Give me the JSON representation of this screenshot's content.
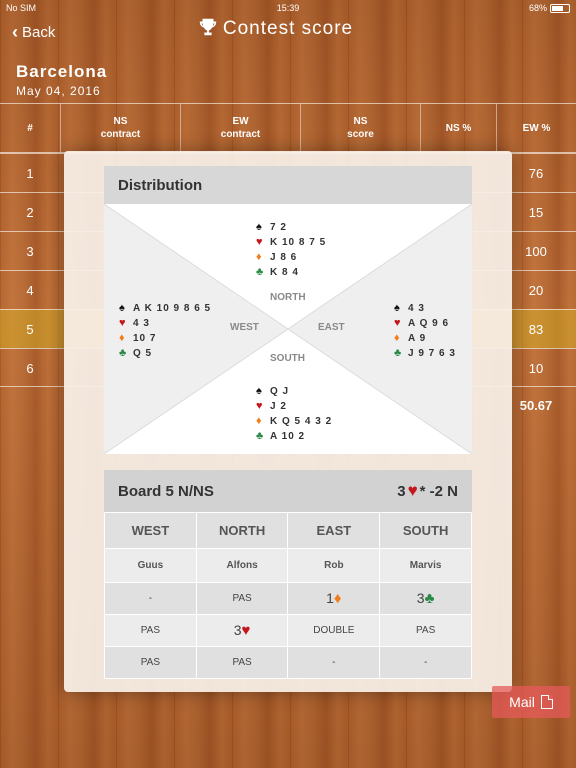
{
  "status": {
    "carrier": "No SIM",
    "time": "15:39",
    "battery": "68%"
  },
  "nav": {
    "back_label": "Back",
    "title": "Contest score"
  },
  "venue": {
    "name": "Barcelona",
    "date": "May 04, 2016"
  },
  "table": {
    "headers": {
      "num": "#",
      "ns_contract": "NS\ncontract",
      "ew_contract": "EW\ncontract",
      "ns_score": "NS\nscore",
      "ns_pct": "NS %",
      "ew_pct": "EW %"
    },
    "rows": [
      {
        "num": "1",
        "ew_pct": "76"
      },
      {
        "num": "2",
        "ew_pct": "15"
      },
      {
        "num": "3",
        "ew_pct": "100"
      },
      {
        "num": "4",
        "ew_pct": "20"
      },
      {
        "num": "5",
        "ew_pct": "83"
      },
      {
        "num": "6",
        "ew_pct": "10"
      }
    ],
    "total_ew": "50.67"
  },
  "distribution": {
    "title": "Distribution",
    "north": {
      "spades": "7 2",
      "hearts": "K 10 8 7 5",
      "diamonds": "J 8 6",
      "clubs": "K 8 4"
    },
    "west": {
      "spades": "A K 10 9 8 6 5",
      "hearts": "4 3",
      "diamonds": "10 7",
      "clubs": "Q 5"
    },
    "east": {
      "spades": "4 3",
      "hearts": "A Q 9 6",
      "diamonds": "A 9",
      "clubs": "J 9 7 6 3"
    },
    "south": {
      "spades": "Q J",
      "hearts": "J 2",
      "diamonds": "K Q 5 4 3 2",
      "clubs": "A 10 2"
    },
    "labels": {
      "north": "NORTH",
      "west": "WEST",
      "east": "EAST",
      "south": "SOUTH"
    }
  },
  "board": {
    "title": "Board 5 N/NS",
    "result_level": "3",
    "result_suffix": "* -2 N",
    "directions": [
      "WEST",
      "NORTH",
      "EAST",
      "SOUTH"
    ],
    "players": [
      "Guus",
      "Alfons",
      "Rob",
      "Marvis"
    ],
    "bids": [
      [
        "-",
        "PAS",
        "1",
        "3"
      ],
      [
        "PAS",
        "3",
        "DOUBLE",
        "PAS"
      ],
      [
        "PAS",
        "PAS",
        "-",
        "-"
      ]
    ]
  },
  "mail": {
    "label": "Mail"
  },
  "colors": {
    "heart": "#c4161c",
    "diamond": "#ef7d1c",
    "club": "#2a8a45",
    "spade": "#111111",
    "highlight": "#d2aa28"
  }
}
